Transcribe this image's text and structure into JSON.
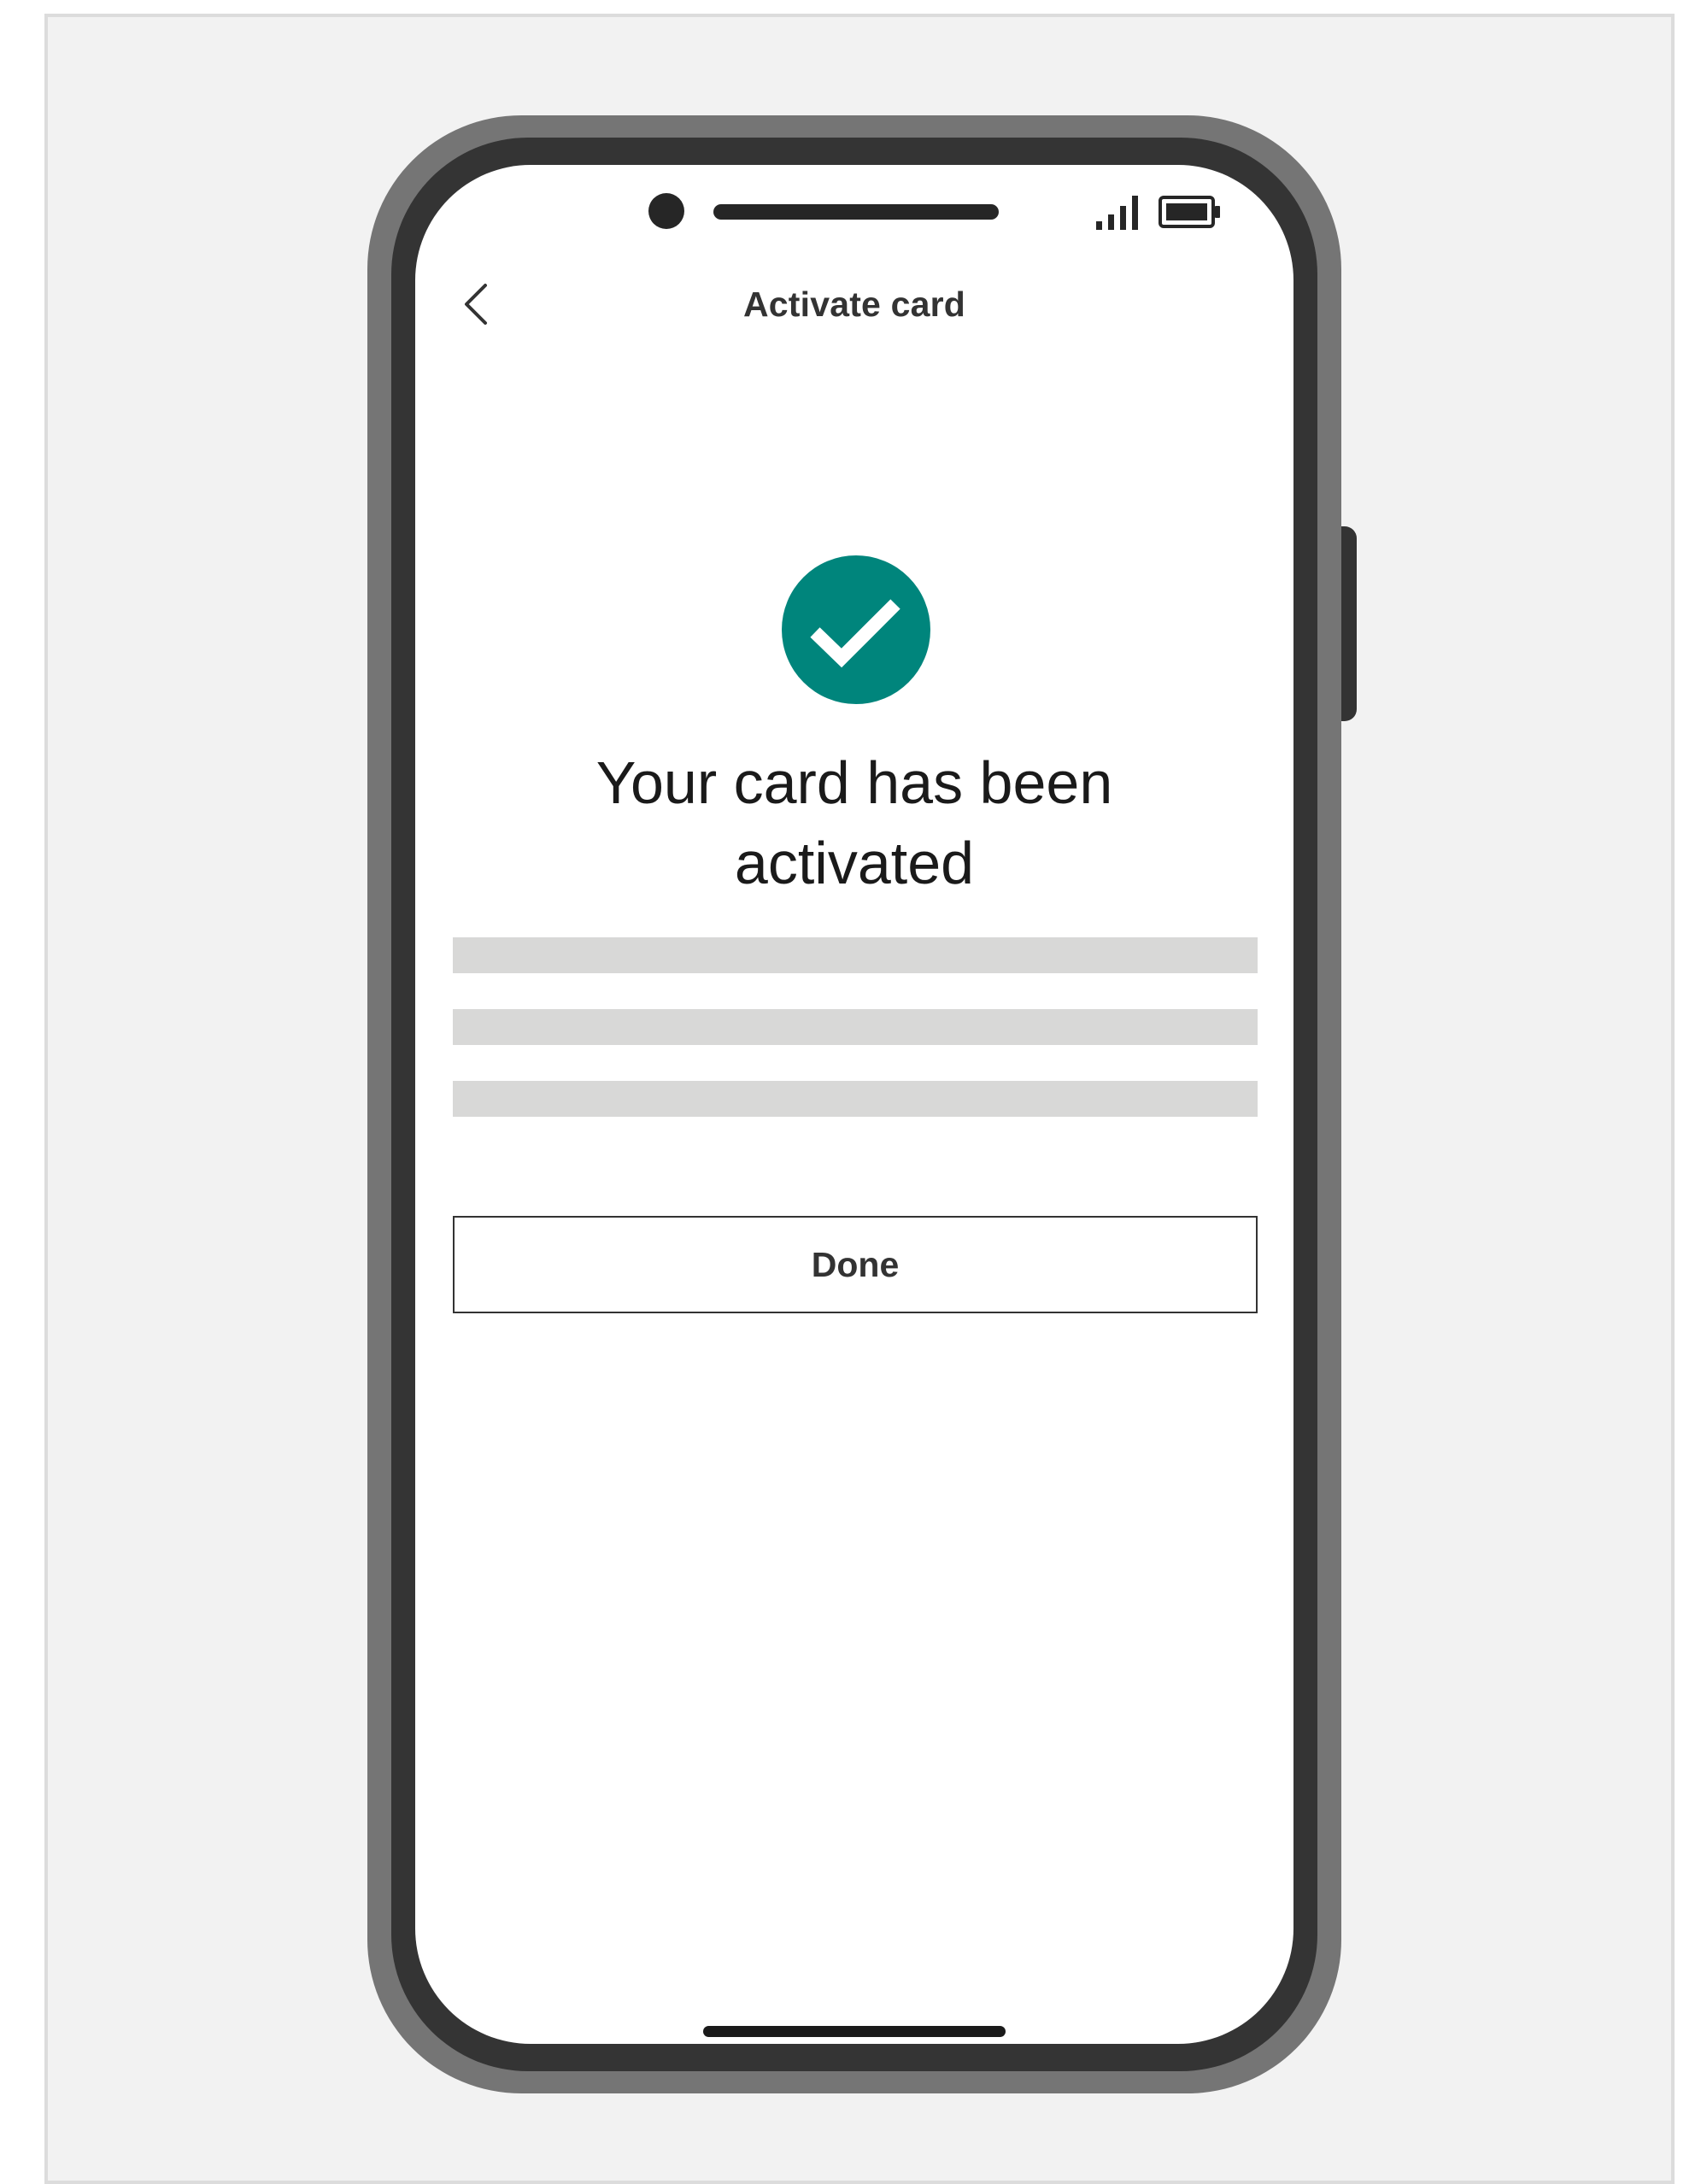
{
  "header": {
    "title": "Activate card",
    "back_icon": "chevron-left-icon"
  },
  "status_bar": {
    "signal_icon": "signal-icon",
    "battery_icon": "battery-icon"
  },
  "confirmation": {
    "icon": "check-circle-icon",
    "icon_color": "#00857c",
    "heading_line1": "Your card has been",
    "heading_line2": "activated"
  },
  "actions": {
    "done_label": "Done"
  },
  "colors": {
    "accent": "#00857c",
    "placeholder": "#d8d8d7",
    "device_frame": "#757575",
    "device_bezel": "#343434"
  }
}
